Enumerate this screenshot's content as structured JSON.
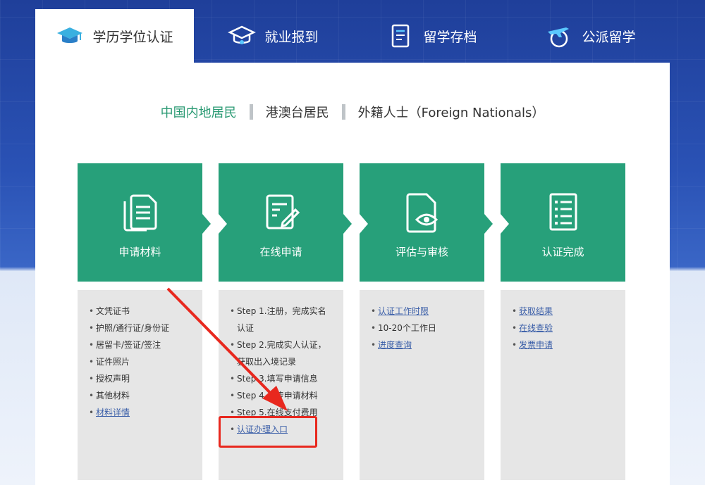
{
  "tabs": [
    {
      "label": "学历学位认证",
      "icon": "graduation-cap-icon"
    },
    {
      "label": "就业报到",
      "icon": "graduation-cap-outline-icon"
    },
    {
      "label": "留学存档",
      "icon": "document-archive-icon"
    },
    {
      "label": "公派留学",
      "icon": "airplane-globe-icon"
    }
  ],
  "regions": [
    {
      "label": "中国内地居民",
      "active": true
    },
    {
      "label": "港澳台居民",
      "active": false
    },
    {
      "label": "外籍人士（Foreign Nationals）",
      "active": false
    }
  ],
  "steps": [
    {
      "label": "申请材料",
      "icon": "documents-icon"
    },
    {
      "label": "在线申请",
      "icon": "form-edit-icon"
    },
    {
      "label": "评估与审核",
      "icon": "document-eye-icon"
    },
    {
      "label": "认证完成",
      "icon": "checklist-icon"
    }
  ],
  "lists": {
    "materials": [
      "文凭证书",
      "护照/通行证/身份证",
      "居留卡/签证/签注",
      "证件照片",
      "授权声明",
      "其他材料",
      "材料详情"
    ],
    "online": {
      "step1a": "Step 1.注册，完成实名",
      "step1b": "认证",
      "step2a": "Step 2.完成实人认证，",
      "step2b": "获取出入境记录",
      "step3": "Step 3.填写申请信息",
      "step4": "Step 4.上传申请材料",
      "step5": "Step 5.在线支付费用",
      "entry": "认证办理入口"
    },
    "review": [
      "认证工作时限",
      "10-20个工作日",
      "进度查询"
    ],
    "complete": [
      "获取结果",
      "在线查验",
      "发票申请"
    ]
  },
  "colors": {
    "accent": "#27a07a",
    "highlight": "#e8281e",
    "link": "#3a5ea8"
  }
}
